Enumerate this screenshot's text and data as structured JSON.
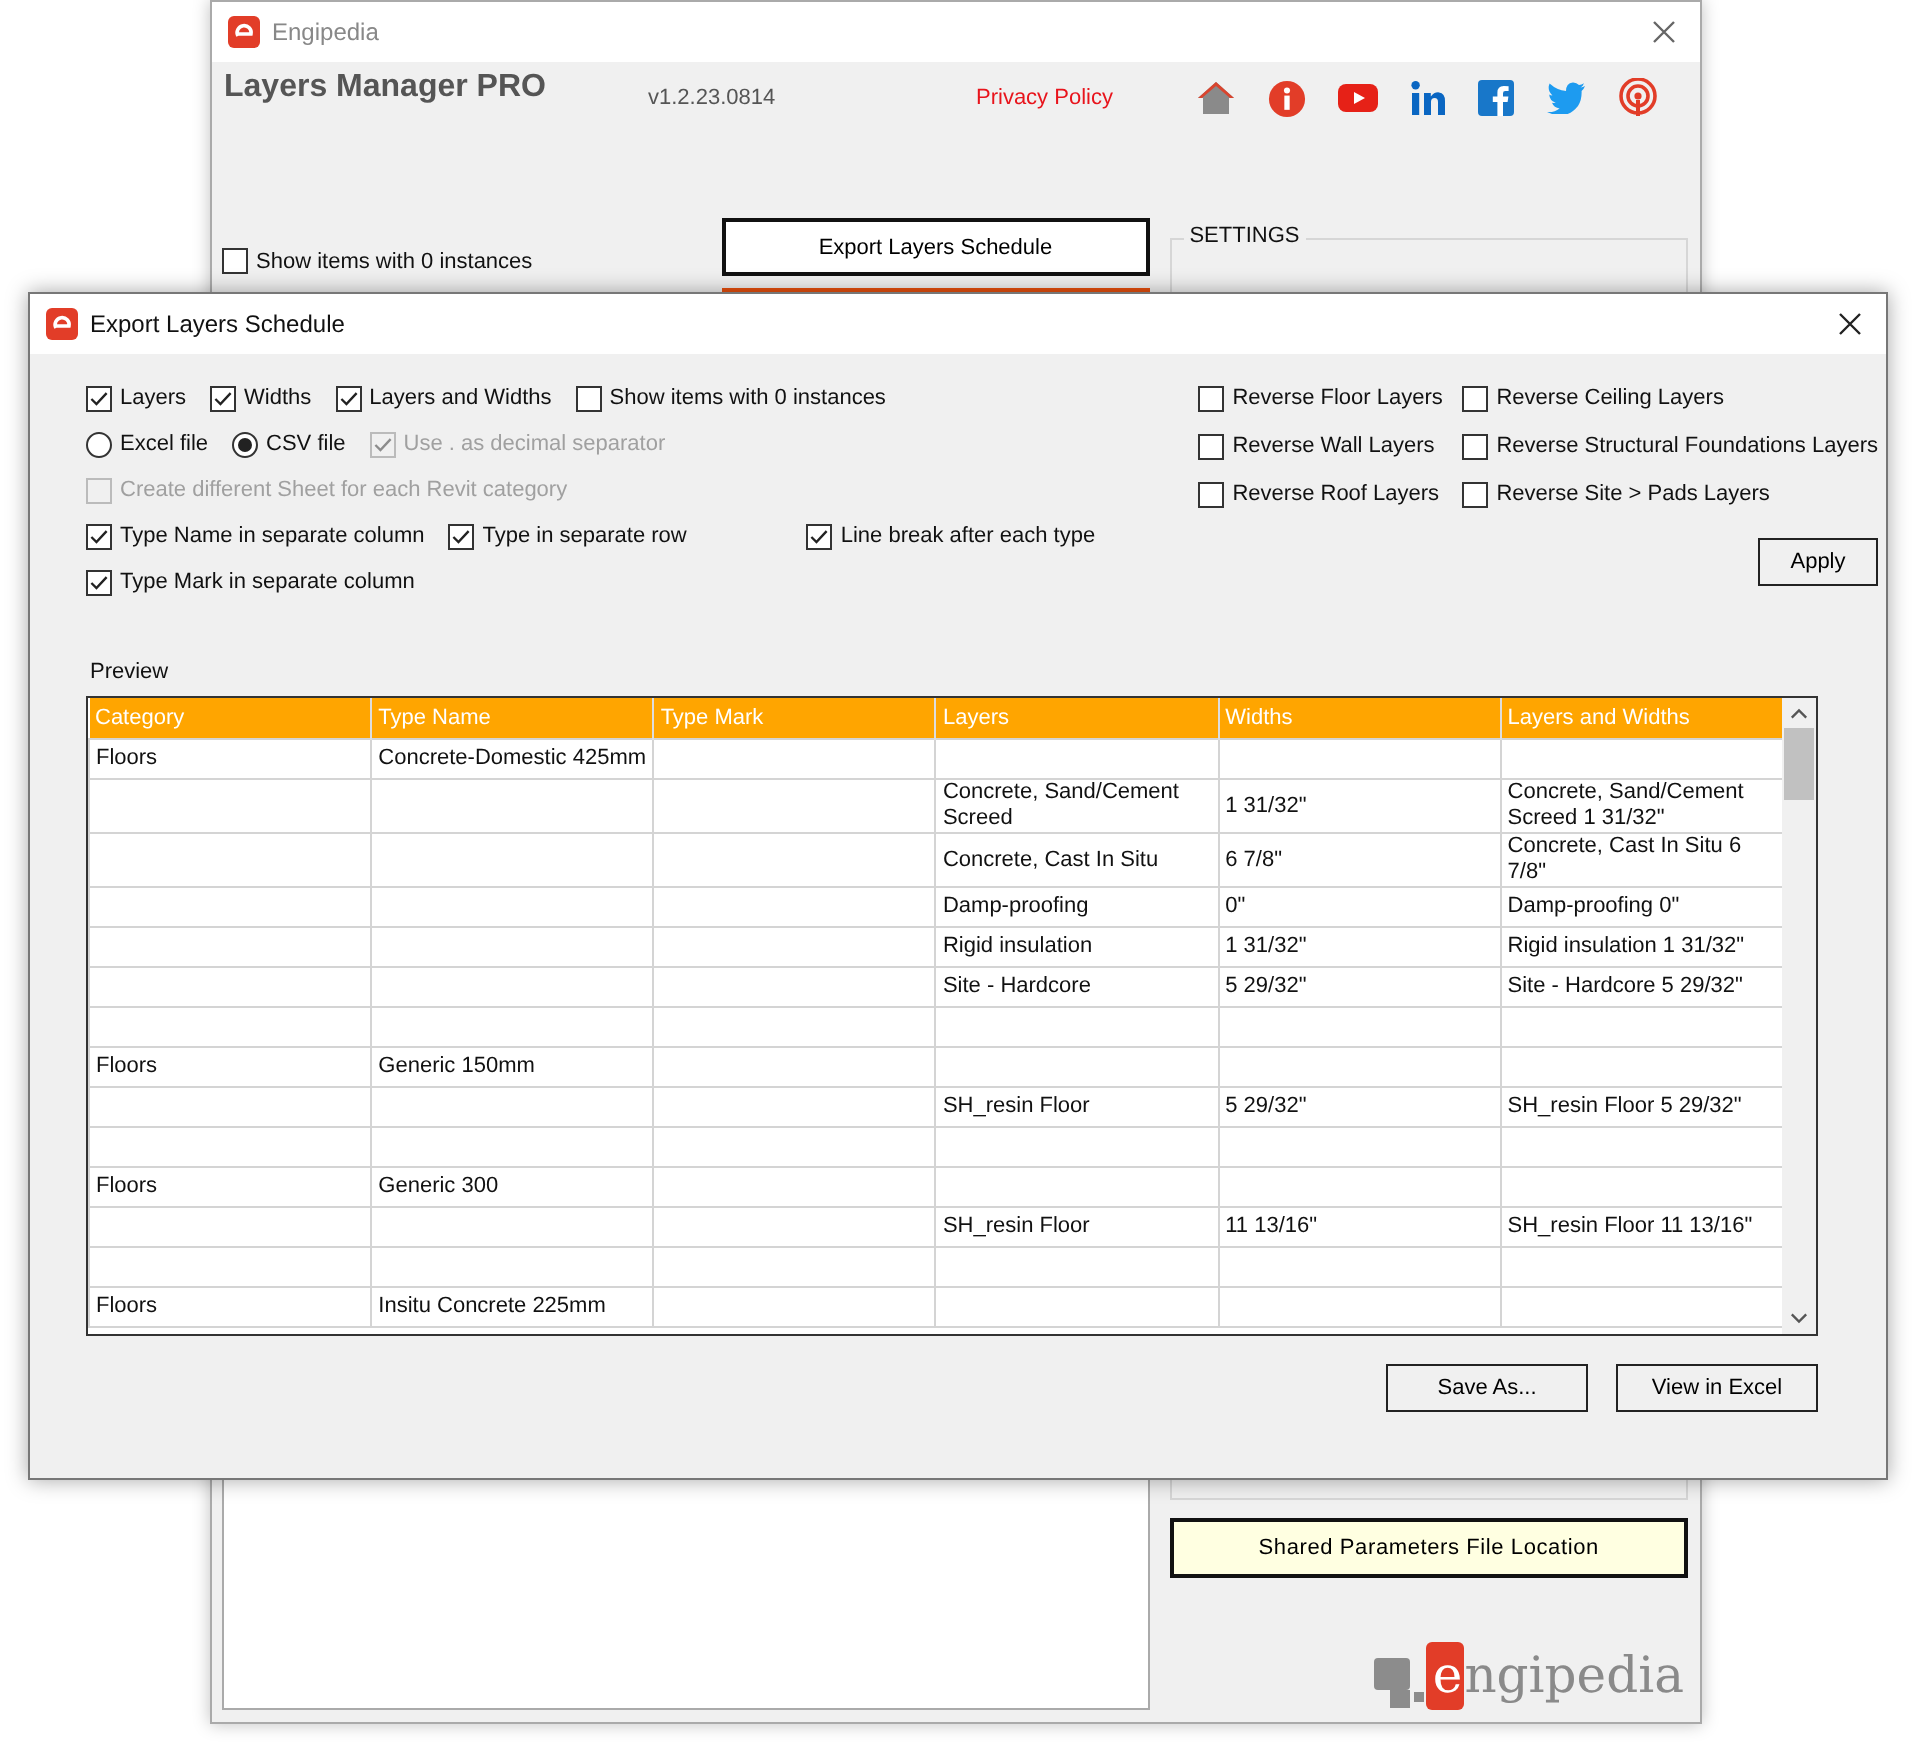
{
  "main_window": {
    "title": "Engipedia",
    "app_name": "Layers Manager PRO",
    "version": "v1.2.23.0814",
    "privacy_link": "Privacy Policy",
    "show_zero_checkbox": {
      "label": "Show items with 0 instances",
      "checked": false
    },
    "export_button": "Export Layers Schedule",
    "settings_title": "SETTINGS",
    "shared_params_button": "Shared Parameters File Location",
    "logo_text": "engipedia"
  },
  "dialog": {
    "title": "Export Layers Schedule",
    "options": [
      [
        {
          "kind": "checkbox",
          "label": "Layers",
          "checked": true,
          "disabled": false
        },
        {
          "kind": "checkbox",
          "label": "Widths",
          "checked": true,
          "disabled": false
        },
        {
          "kind": "checkbox",
          "label": "Layers and Widths",
          "checked": true,
          "disabled": false
        },
        {
          "kind": "checkbox",
          "label": "Show items with 0 instances",
          "checked": false,
          "disabled": false
        }
      ],
      [
        {
          "kind": "radio",
          "label": "Excel file",
          "selected": false,
          "disabled": false
        },
        {
          "kind": "radio",
          "label": "CSV file",
          "selected": true,
          "disabled": false
        },
        {
          "kind": "checkbox",
          "label": "Use . as decimal separator",
          "checked": true,
          "disabled": true
        }
      ],
      [
        {
          "kind": "checkbox",
          "label": "Create different Sheet for each Revit category",
          "checked": false,
          "disabled": true
        }
      ],
      [
        {
          "kind": "checkbox",
          "label": "Type Name in separate column",
          "checked": true,
          "disabled": false
        },
        {
          "kind": "checkbox",
          "label": "Type in separate row",
          "checked": true,
          "disabled": false
        },
        {
          "kind": "checkbox",
          "label": "Line break after each type",
          "checked": true,
          "disabled": false
        }
      ],
      [
        {
          "kind": "checkbox",
          "label": "Type Mark in separate column",
          "checked": true,
          "disabled": false
        }
      ]
    ],
    "reverse_options": [
      {
        "label": "Reverse Floor Layers",
        "checked": false
      },
      {
        "label": "Reverse Ceiling Layers",
        "checked": false
      },
      {
        "label": "Reverse Wall Layers",
        "checked": false
      },
      {
        "label": "Reverse Structural Foundations Layers",
        "checked": false
      },
      {
        "label": "Reverse Roof Layers",
        "checked": false
      },
      {
        "label": "Reverse Site > Pads Layers",
        "checked": false
      }
    ],
    "apply_button": "Apply",
    "preview_label": "Preview",
    "table": {
      "columns": [
        "Category",
        "Type Name",
        "Type Mark",
        "Layers",
        "Widths",
        "Layers and Widths"
      ],
      "rows": [
        {
          "category": "Floors",
          "type_name": "Concrete-Domestic 425mm"
        },
        {
          "layers": "Concrete, Sand/Cement Screed",
          "widths": "1 31/32\"",
          "layers_and_widths": "Concrete, Sand/Cement Screed 1 31/32\""
        },
        {
          "layers": "Concrete, Cast In Situ",
          "widths": "6 7/8\"",
          "layers_and_widths": "Concrete, Cast In Situ 6 7/8\""
        },
        {
          "layers": "Damp-proofing",
          "widths": "0\"",
          "layers_and_widths": "Damp-proofing 0\""
        },
        {
          "layers": "Rigid insulation",
          "widths": "1 31/32\"",
          "layers_and_widths": "Rigid insulation 1 31/32\""
        },
        {
          "layers": "Site - Hardcore",
          "widths": "5 29/32\"",
          "layers_and_widths": "Site - Hardcore 5 29/32\""
        },
        {},
        {
          "category": "Floors",
          "type_name": "Generic 150mm"
        },
        {
          "layers": "SH_resin Floor",
          "widths": "5 29/32\"",
          "layers_and_widths": "SH_resin Floor 5 29/32\""
        },
        {},
        {
          "category": "Floors",
          "type_name": "Generic 300"
        },
        {
          "layers": "SH_resin Floor",
          "widths": "11 13/16\"",
          "layers_and_widths": "SH_resin Floor 11 13/16\""
        },
        {},
        {
          "category": "Floors",
          "type_name": "Insitu Concrete 225mm"
        }
      ]
    },
    "buttons": [
      "Save As...",
      "View in Excel"
    ]
  }
}
